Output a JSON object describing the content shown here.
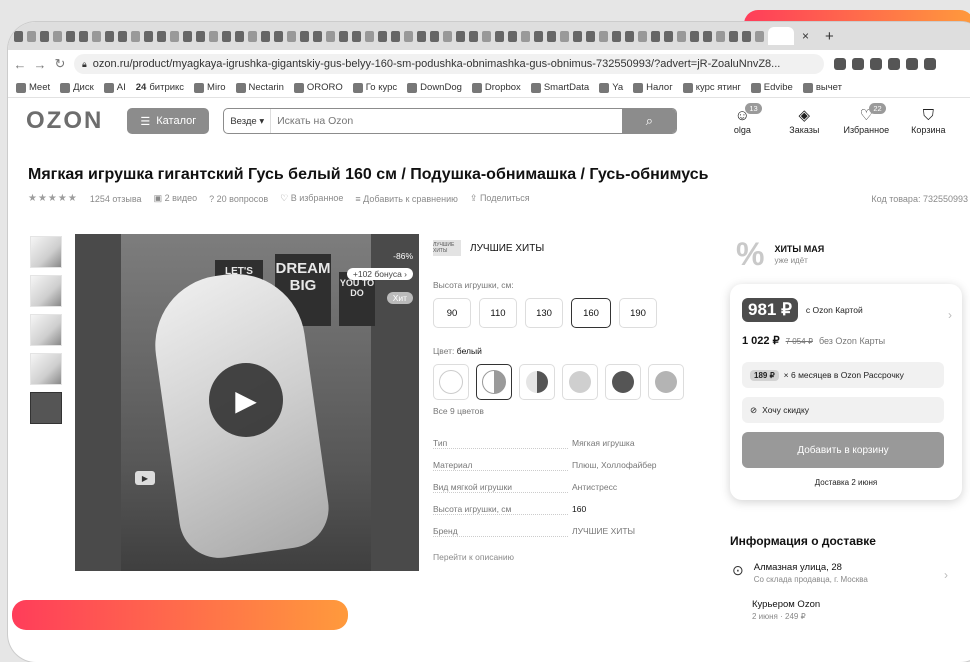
{
  "browser": {
    "url": "ozon.ru/product/myagkaya-igrushka-gigantskiy-gus-belyy-160-sm-podushka-obnimashka-gus-obnimus-732550993/?advert=jR-ZoaluNnvZ8...",
    "bookmarks": [
      "Meet",
      "Диск",
      "AI",
      "битрикс",
      "Miro",
      "Nectarin",
      "ORORO",
      "Го курс",
      "DownDog",
      "Dropbox",
      "SmartData",
      "Ya",
      "Налог",
      "курс ятинг",
      "Edvibe",
      "вычет"
    ],
    "bookmark_24": "24",
    "tab_close": "×",
    "new_tab": "+"
  },
  "header": {
    "logo": "OZON",
    "catalog_label": "Каталог",
    "search_scope": "Везде ▾",
    "search_placeholder": "Искать на Ozon",
    "icons": [
      {
        "label": "olga",
        "badge": "13"
      },
      {
        "label": "Заказы",
        "badge": ""
      },
      {
        "label": "Избранное",
        "badge": "22"
      },
      {
        "label": "Корзина",
        "badge": ""
      }
    ]
  },
  "product": {
    "title": "Мягкая игрушка гигантский Гусь белый 160 см / Подушка-обнимашка / Гусь-обнимусь",
    "stars": "★★★★★",
    "reviews": "1254 отзыва",
    "videos": "2 видео",
    "questions": "20 вопросов",
    "favorite": "В избранное",
    "compare": "Добавить к сравнению",
    "share": "Поделиться",
    "code": "Код товара: 732550993",
    "media": {
      "discount": "-86%",
      "bonus": "+102 бонуса ›",
      "hit": "Хит",
      "poster1": "LET'S GET LOST",
      "poster2": "DREAM BIG",
      "poster3": "YOU TO DO"
    },
    "brand_logo_text": "ЛУЧШИЕ ХИТЫ",
    "brand": "ЛУЧШИЕ ХИТЫ",
    "height_label": "Высота игрушки, см:",
    "sizes": [
      "90",
      "110",
      "130",
      "160",
      "190"
    ],
    "selected_size": "160",
    "color_label": "Цвет:",
    "color_value": "белый",
    "all_colors": "Все 9 цветов",
    "specs": [
      {
        "k": "Тип",
        "v": "Мягкая игрушка"
      },
      {
        "k": "Материал",
        "v": "Плюш, Холлофайбер"
      },
      {
        "k": "Вид мягкой игрушки",
        "v": "Антистресс"
      },
      {
        "k": "Высота игрушки, см",
        "v": "160"
      },
      {
        "k": "Бренд",
        "v": "ЛУЧШИЕ ХИТЫ"
      }
    ],
    "to_description": "Перейти к описанию"
  },
  "promo": {
    "line1": "ХИТЫ МАЯ",
    "line2": "уже идёт"
  },
  "buy": {
    "price_card": "981 ₽",
    "price_card_caption": "с Ozon Картой",
    "price": "1 022 ₽",
    "price_old": "7 054 ₽",
    "price_caption": "без Ozon Карты",
    "installment_tag": "189 ₽",
    "installment_text": "× 6 месяцев в Ozon Рассрочку",
    "discount_text": "Хочу скидку",
    "add_to_cart": "Добавить в корзину",
    "delivery": "Доставка 2 июня"
  },
  "delivery_info": {
    "heading": "Информация о доставке",
    "address": "Алмазная улица, 28",
    "address_sub": "Со склада продавца, г. Москва",
    "courier": "Курьером Ozon",
    "courier_sub": "2 июня · 249 ₽"
  },
  "colors": {
    "accent_start": "#ff3d5a",
    "accent_end": "#ff9a3c"
  }
}
